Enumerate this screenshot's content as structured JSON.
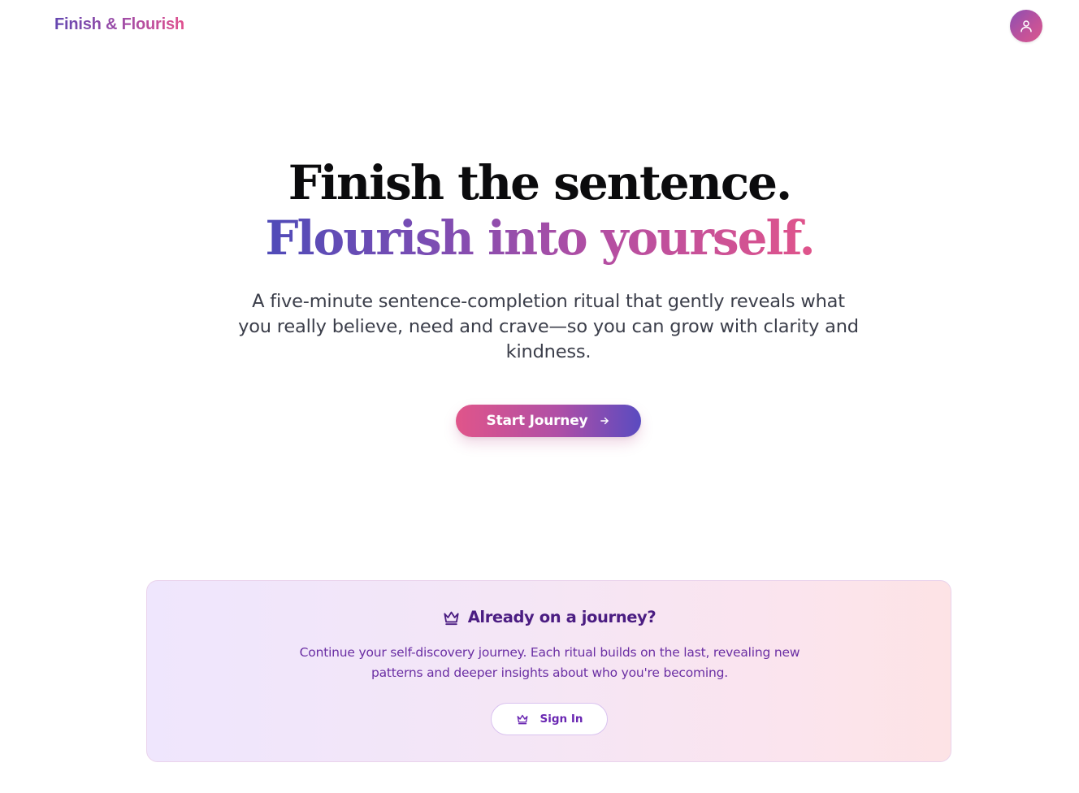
{
  "header": {
    "brand": "Finish & Flourish",
    "avatar_icon": "user-icon"
  },
  "hero": {
    "title_line1": "Finish the sentence.",
    "title_line2": "Flourish into yourself.",
    "subtitle": "A five-minute sentence-completion ritual that gently reveals what you really believe, need and crave—so you can grow with clarity and kindness.",
    "cta_label": "Start Journey",
    "cta_icon": "arrow-right-icon"
  },
  "returning_card": {
    "title": "Already on a journey?",
    "title_icon": "crown-icon",
    "text": "Continue your self-discovery journey. Each ritual builds on the last, revealing new patterns and deeper insights about who you're becoming.",
    "signin_label": "Sign In",
    "signin_icon": "crown-icon"
  },
  "colors": {
    "brand_purple": "#6447b0",
    "brand_pink": "#e0508e",
    "title_dark": "#0b0b0d",
    "card_title": "#4b1d82",
    "card_text": "#6a2ea3"
  }
}
